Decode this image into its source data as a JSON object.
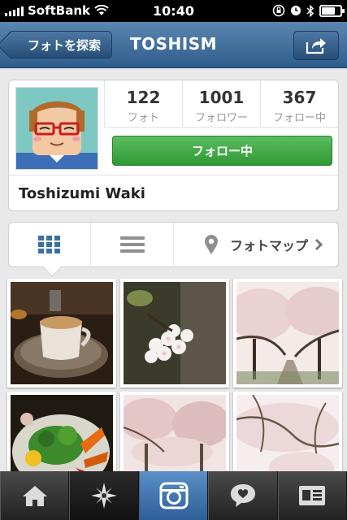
{
  "status_bar": {
    "carrier": "SoftBank",
    "time": "10:40"
  },
  "nav": {
    "back_label": "フォトを探索",
    "title": "TOSHISM",
    "share_icon": "share-icon"
  },
  "profile": {
    "stats": [
      {
        "value": "122",
        "label": "フォト"
      },
      {
        "value": "1001",
        "label": "フォロワー"
      },
      {
        "value": "367",
        "label": "フォロー中"
      }
    ],
    "follow_button": "フォロー中",
    "name": "Toshizumi Waki"
  },
  "view_switcher": {
    "map_label": "フォトマップ"
  },
  "tab_bar": {
    "tabs": [
      {
        "icon": "home-icon"
      },
      {
        "icon": "explore-icon"
      },
      {
        "icon": "camera-icon"
      },
      {
        "icon": "activity-icon"
      },
      {
        "icon": "profile-icon"
      }
    ]
  },
  "colors": {
    "nav_blue": "#2f5d8c",
    "follow_green": "#2e9a33",
    "grid_blue": "#3a6fa8"
  }
}
